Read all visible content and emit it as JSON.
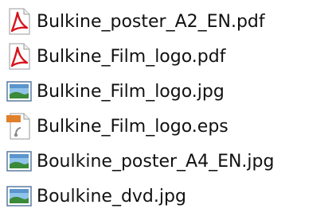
{
  "files": [
    {
      "name": "Bulkine_poster_A2_EN.pdf",
      "icon": "pdf-icon"
    },
    {
      "name": "Bulkine_Film_logo.pdf",
      "icon": "pdf-icon"
    },
    {
      "name": "Bulkine_Film_logo.jpg",
      "icon": "image-icon"
    },
    {
      "name": "Bulkine_Film_logo.eps",
      "icon": "eps-icon"
    },
    {
      "name": "Boulkine_poster_A4_EN.jpg",
      "icon": "image-icon"
    },
    {
      "name": "Boulkine_dvd.jpg",
      "icon": "image-icon"
    }
  ],
  "colors": {
    "pdf_red": "#d7141a",
    "image_blue": "#2f6fb5",
    "image_green": "#3a8a3a",
    "eps_orange": "#e0802a"
  }
}
